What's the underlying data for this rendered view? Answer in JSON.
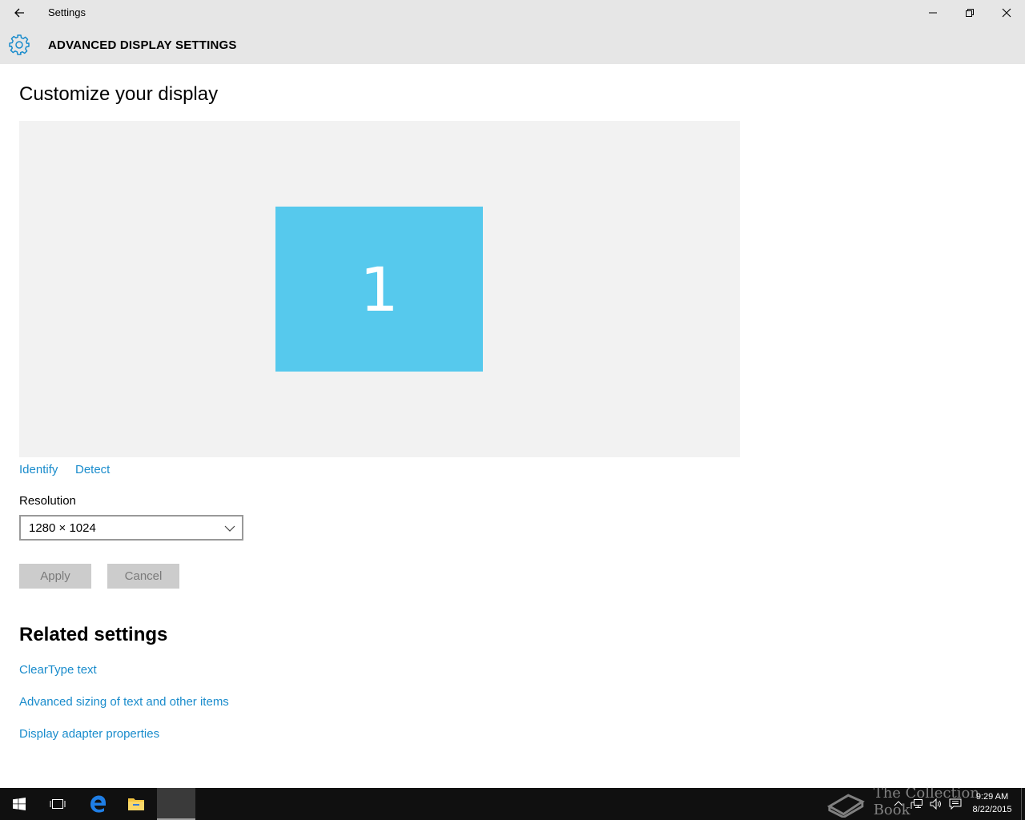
{
  "window": {
    "title": "Settings"
  },
  "header": {
    "title": "ADVANCED DISPLAY SETTINGS"
  },
  "main": {
    "page_title": "Customize your display",
    "monitor_number": "1",
    "identify_label": "Identify",
    "detect_label": "Detect",
    "resolution_label": "Resolution",
    "resolution_value": "1280 × 1024",
    "apply_label": "Apply",
    "cancel_label": "Cancel"
  },
  "related": {
    "title": "Related settings",
    "links": [
      "ClearType text",
      "Advanced sizing of text and other items",
      "Display adapter properties"
    ]
  },
  "taskbar": {
    "time": "9:29 AM",
    "date": "8/22/2015",
    "icons": [
      "windows-start-icon",
      "task-view-icon",
      "edge-icon",
      "file-explorer-icon",
      "settings-app-icon"
    ]
  },
  "watermark": {
    "text": "The Collection Book"
  },
  "colors": {
    "accent": "#1a8ccc",
    "monitor": "#56c9ed",
    "chrome": "#e6e6e6",
    "taskbar": "#101010"
  }
}
